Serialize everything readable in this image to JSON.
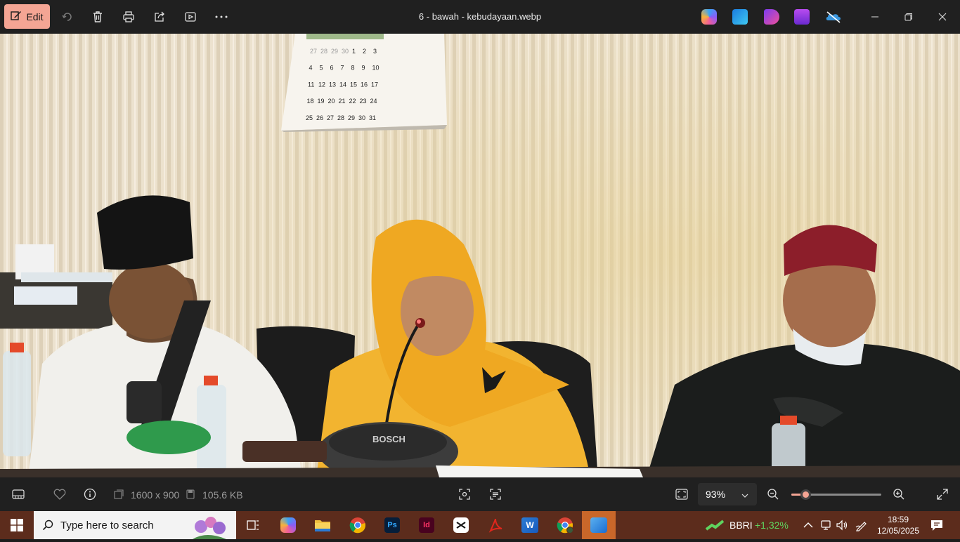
{
  "toolbar": {
    "edit_label": "Edit",
    "title": "6 - bawah - kebudayaan.webp",
    "icons": [
      "edit-icon",
      "rotate-icon",
      "delete-icon",
      "print-icon",
      "share-icon",
      "slideshow-icon",
      "more-icon"
    ],
    "apps": [
      "copilot-icon",
      "designer-icon",
      "clipchamp-icon",
      "photos-icon",
      "onedrive-icon"
    ]
  },
  "statusbar": {
    "dimensions": "1600 x 900",
    "file_size": "105.6 KB",
    "zoom": "93%",
    "zoom_level": 0.16
  },
  "taskbar": {
    "search_placeholder": "Type here to search",
    "ticker_name": "BBRI",
    "ticker_change": "+1,32%",
    "time": "18:59",
    "date": "12/05/2025"
  },
  "colors": {
    "accent": "#f4a594",
    "taskbar": "#5c2c1c",
    "active_app": "#c9672a"
  },
  "photo": {
    "calendar_numbers": [
      "27",
      "28",
      "29",
      "30",
      "1",
      "2",
      "3",
      "4",
      "5",
      "6",
      "7",
      "8",
      "9",
      "10",
      "11",
      "12",
      "13",
      "14",
      "15",
      "16",
      "17",
      "18",
      "19",
      "20",
      "21",
      "22",
      "23",
      "24",
      "25",
      "26",
      "27",
      "28",
      "29",
      "30",
      "31"
    ],
    "mic_brand": "BOSCH"
  }
}
